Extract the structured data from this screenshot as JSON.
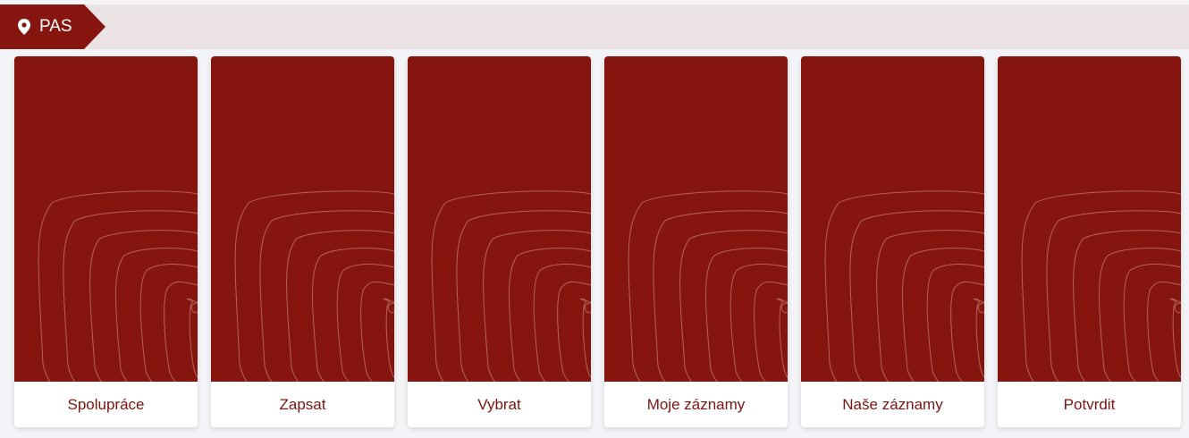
{
  "breadcrumb": {
    "label": "PAS",
    "icon": "map-pin-icon"
  },
  "colors": {
    "brand": "#861510",
    "label_text": "#7a1510",
    "topbar_bg": "#ebe3e3",
    "card_bg": "#ffffff"
  },
  "cards": [
    {
      "label": "Spolupráce"
    },
    {
      "label": "Zapsat"
    },
    {
      "label": "Vybrat"
    },
    {
      "label": "Moje záznamy"
    },
    {
      "label": "Naše záznamy"
    },
    {
      "label": "Potvrdit"
    }
  ]
}
